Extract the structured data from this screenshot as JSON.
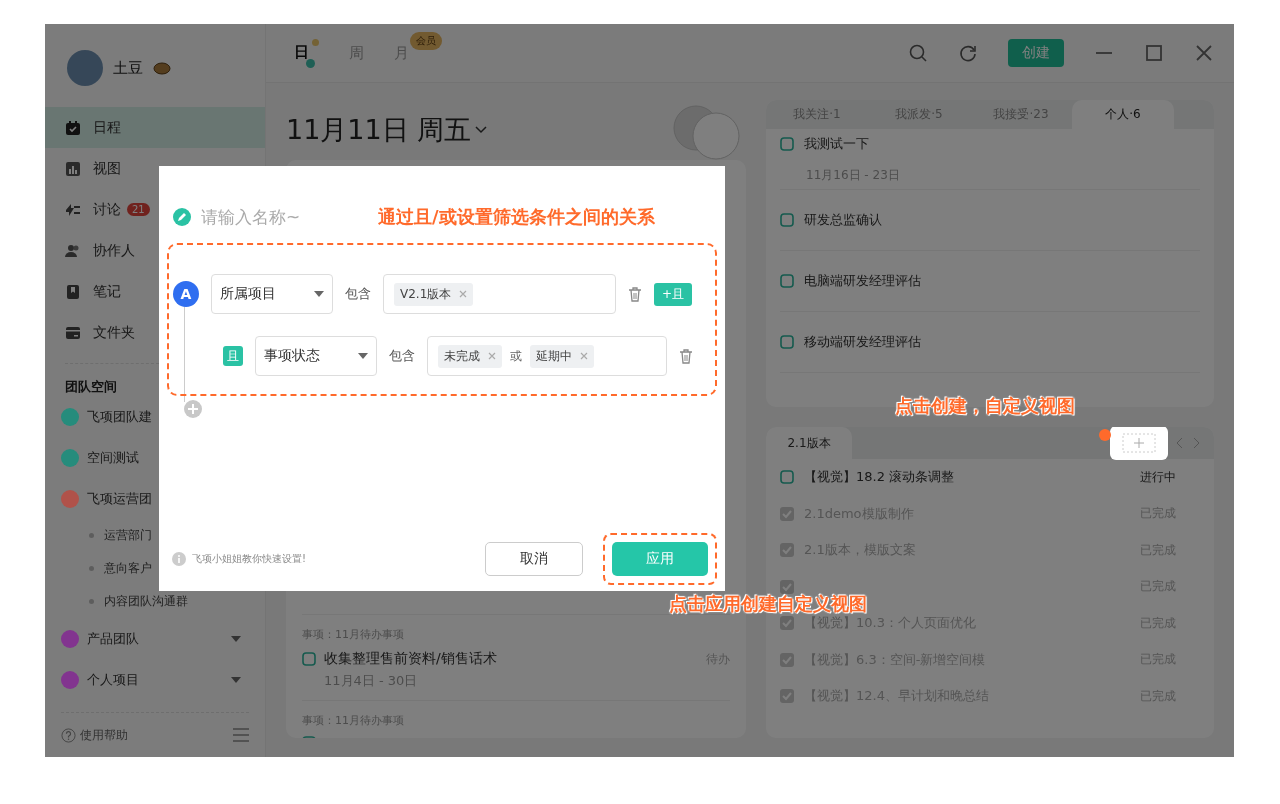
{
  "user": {
    "name": "土豆"
  },
  "sidebar": {
    "items": [
      {
        "label": "日程",
        "selected": true
      },
      {
        "label": "视图",
        "selected": false
      },
      {
        "label": "讨论",
        "selected": false,
        "badge": "21"
      },
      {
        "label": "协作人",
        "selected": false
      },
      {
        "label": "笔记",
        "selected": false
      },
      {
        "label": "文件夹",
        "selected": false
      }
    ],
    "section_title": "团队空间",
    "teams": [
      {
        "label": "飞项团队建",
        "color": "#268c7c"
      },
      {
        "label": "空间测试",
        "color": "#268c7c"
      },
      {
        "label": "飞项运营团",
        "color": "#b0524a",
        "children": [
          {
            "label": "运营部门"
          },
          {
            "label": "意向客户"
          },
          {
            "label": "内容团队沟通群"
          }
        ]
      },
      {
        "label": "产品团队",
        "color": "#82348f",
        "expanded": false
      },
      {
        "label": "个人项目",
        "color": "#82348f",
        "expanded": false
      }
    ],
    "help": "使用帮助"
  },
  "view_tabs": [
    {
      "label": "日",
      "selected": true
    },
    {
      "label": "周",
      "selected": false
    },
    {
      "label": "月",
      "selected": false,
      "badge": "会员"
    }
  ],
  "create_button": "创建",
  "date_title": "11月11日 周五",
  "day_items": [
    {
      "category": "事项：11月待办事项",
      "title": "收集整理售前资料/销售话术",
      "date": "11月4日 - 30日",
      "status": "待办",
      "checked": false
    },
    {
      "category": "事项：11月待办事项",
      "checked": false
    }
  ],
  "panel_tabs": [
    {
      "label": "我关注·1",
      "selected": false
    },
    {
      "label": "我派发·5",
      "selected": false
    },
    {
      "label": "我接受·23",
      "selected": false
    },
    {
      "label": "个人·6",
      "selected": true
    }
  ],
  "panel_items": [
    {
      "title": "我测试一下",
      "date": "11月16日 - 23日",
      "checked": false
    },
    {
      "title": "研发总监确认",
      "checked": false
    },
    {
      "title": "电脑端研发经理评估",
      "checked": false
    },
    {
      "title": "移动端研发经理评估",
      "checked": false
    }
  ],
  "view_tab": {
    "label": "2.1版本",
    "selected": true
  },
  "view_items": [
    {
      "title": "【视觉】18.2 滚动条调整",
      "status": "进行中",
      "checked": false
    },
    {
      "title": "2.1demo模版制作",
      "status": "已完成",
      "checked": true
    },
    {
      "title": "2.1版本，模版文案",
      "status": "已完成",
      "checked": true
    },
    {
      "status": "已完成",
      "checked": true
    },
    {
      "title": "【视觉】10.3：个人页面优化",
      "status": "已完成",
      "checked": true
    },
    {
      "title": "【视觉】6.3：空间-新增空间模",
      "status": "已完成",
      "checked": true
    },
    {
      "title": "【视觉】12.4、早计划和晚总结",
      "status": "已完成",
      "checked": true
    }
  ],
  "dialog": {
    "name_placeholder": "请输入名称~",
    "conditions": [
      {
        "kind": "root",
        "badge": "A",
        "field": "所属项目",
        "operator": "包含",
        "values": [
          "V2.1版本"
        ],
        "add_button": "+且"
      },
      {
        "kind": "and",
        "badge": "且",
        "field": "事项状态",
        "operator": "包含",
        "values": [
          "未完成",
          "延期中"
        ],
        "joiner": "或"
      }
    ],
    "hint": "飞项小姐姐教你快速设置!",
    "cancel": "取消",
    "apply": "应用"
  },
  "annotations": [
    {
      "text": "通过且/或设置筛选条件之间的关系"
    },
    {
      "text": "点击创建，自定义视图"
    },
    {
      "text": "点击应用创建自定义视图"
    }
  ]
}
